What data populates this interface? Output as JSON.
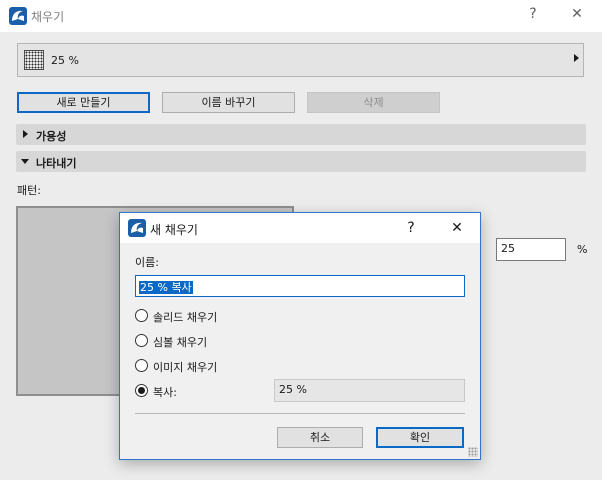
{
  "window": {
    "title": "채우기",
    "help": "?",
    "close": "✕"
  },
  "fill_select": {
    "value": "25 %"
  },
  "buttons": {
    "new": "새로 만들기",
    "rename": "이름 바꾸기",
    "delete": "삭제"
  },
  "sections": {
    "availability": "가용성",
    "appearance": "나타내기"
  },
  "pattern": {
    "label": "패턴:"
  },
  "percent": {
    "value": "25",
    "unit": "%"
  },
  "dialog": {
    "title": "새 채우기",
    "help": "?",
    "close": "✕",
    "name_label": "이름:",
    "name_value": "25 % 복사",
    "options": [
      "솔리드 채우기",
      "심볼 채우기",
      "이미지 채우기",
      "복사:"
    ],
    "selected_option": "복사:",
    "copy_value": "25 %",
    "cancel": "취소",
    "ok": "확인"
  }
}
